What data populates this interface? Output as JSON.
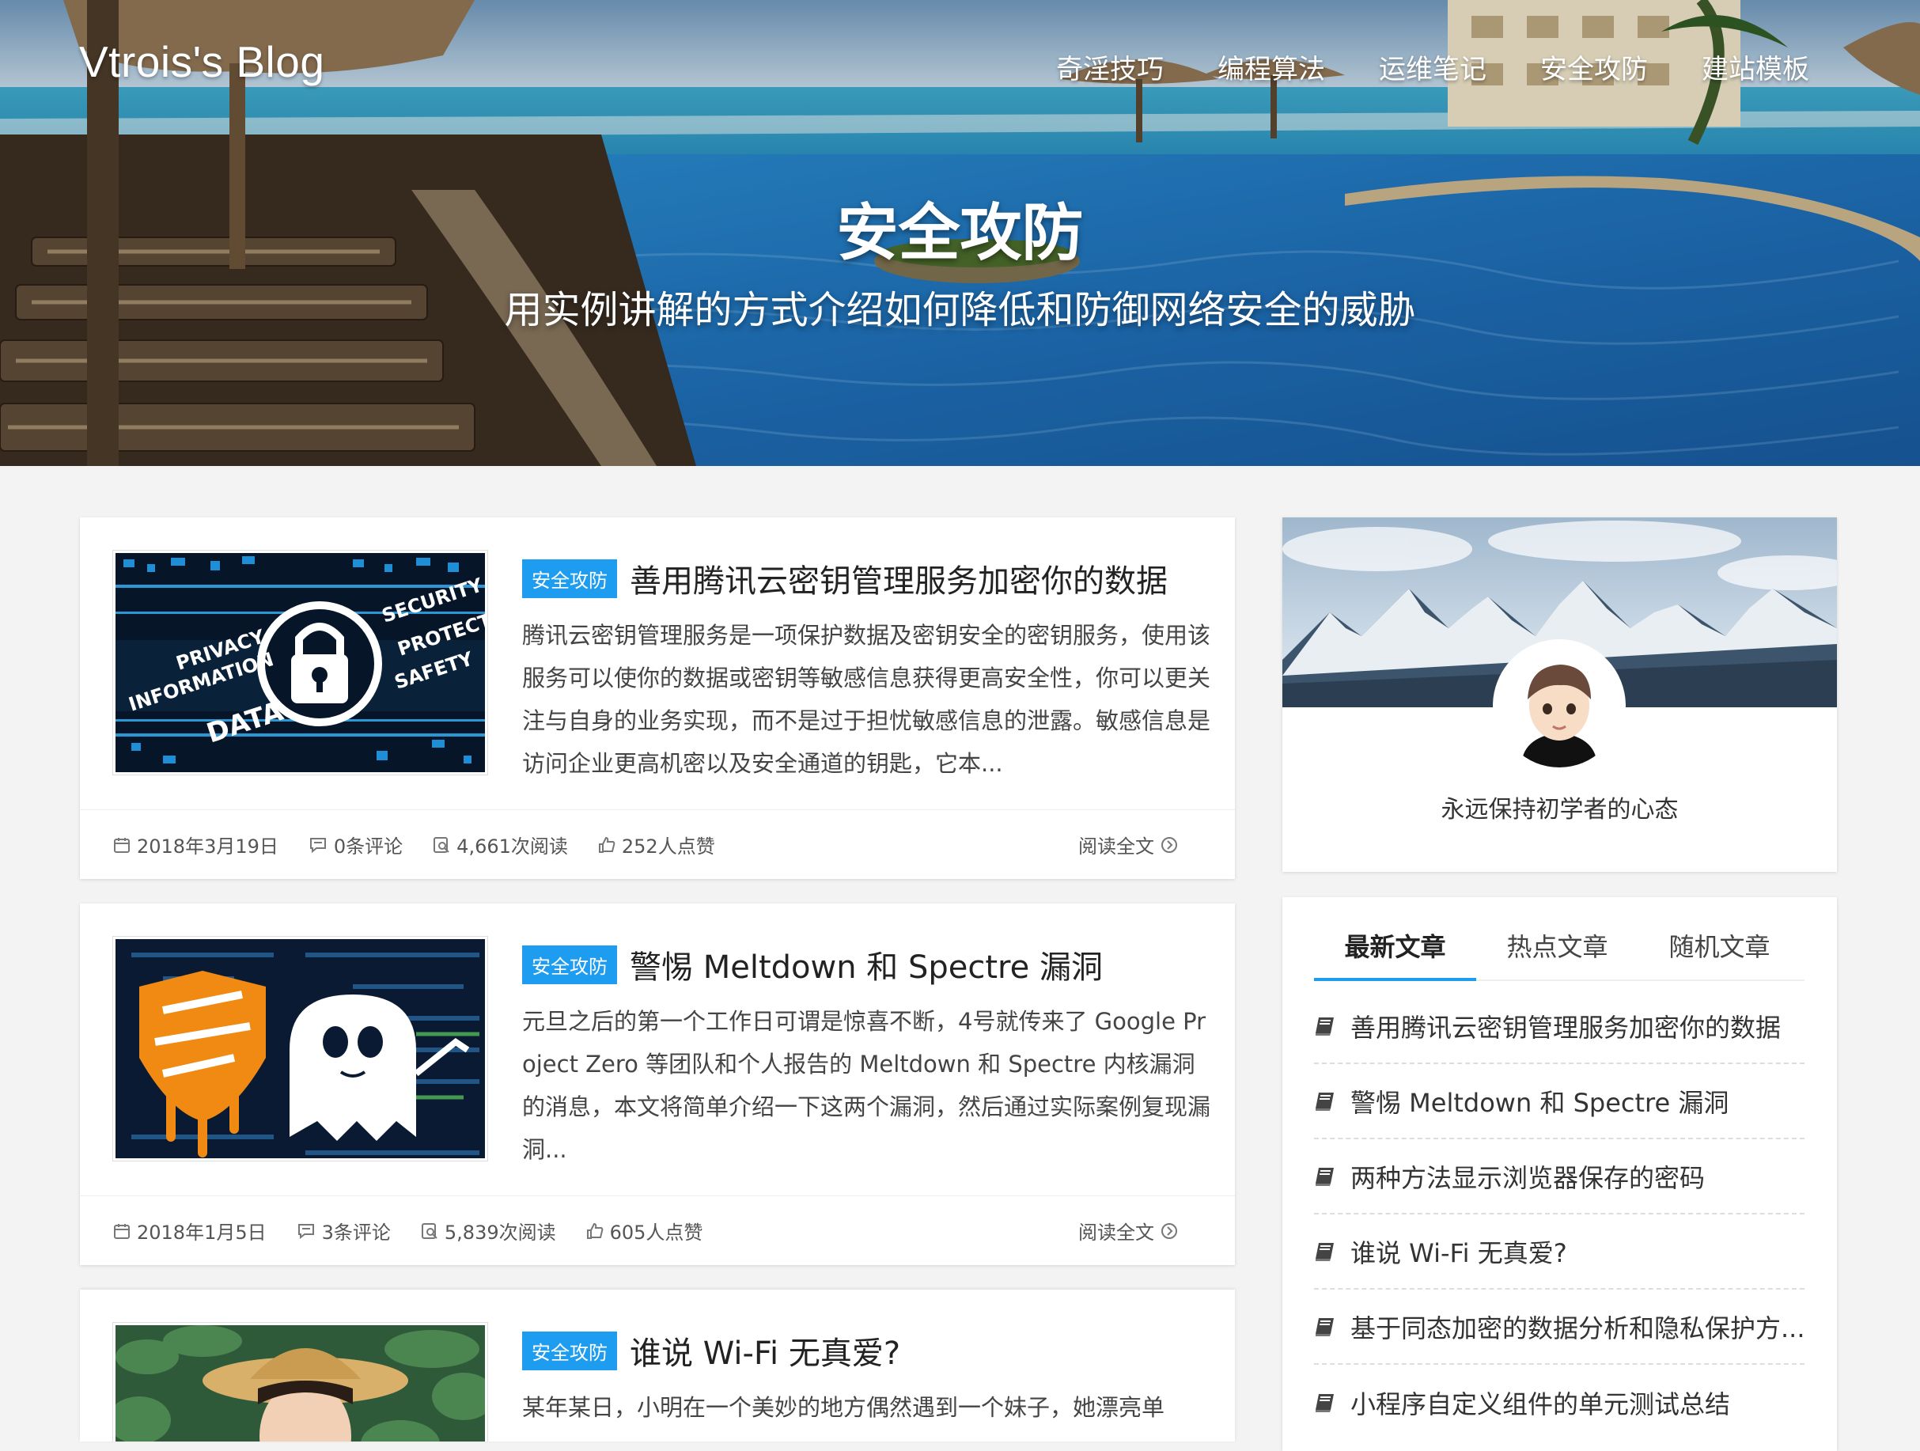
{
  "site": {
    "brand": "Vtrois's Blog"
  },
  "nav": [
    {
      "label": "奇淫技巧"
    },
    {
      "label": "编程算法"
    },
    {
      "label": "运维笔记"
    },
    {
      "label": "安全攻防"
    },
    {
      "label": "建站模板"
    }
  ],
  "hero": {
    "title": "安全攻防",
    "subtitle": "用实例讲解的方式介绍如何降低和防御网络安全的威胁"
  },
  "articles": [
    {
      "tag": "安全攻防",
      "title": "善用腾讯云密钥管理服务加密你的数据",
      "excerpt": "腾讯云密钥管理服务是一项保护数据及密钥安全的密钥服务，使用该服务可以使你的数据或密钥等敏感信息获得更高安全性，你可以更关注与自身的业务实现，而不是过于担忧敏感信息的泄露。敏感信息是访问企业更高机密以及安全通道的钥匙，它本...",
      "date": "2018年3月19日",
      "comments": "0条评论",
      "views": "4,661次阅读",
      "likes": "252人点赞",
      "readmore": "阅读全文",
      "thumb_text": [
        "PRIVACY",
        "INFORMATION",
        "DATA",
        "SECURITY",
        "PROTECT",
        "SAFETY"
      ]
    },
    {
      "tag": "安全攻防",
      "title": "警惕 Meltdown 和 Spectre 漏洞",
      "excerpt": "元旦之后的第一个工作日可谓是惊喜不断，4号就传来了 Google Project Zero 等团队和个人报告的 Meltdown 和 Spectre 内核漏洞的消息，本文将简单介绍一下这两个漏洞，然后通过实际案例复现漏洞...",
      "date": "2018年1月5日",
      "comments": "3条评论",
      "views": "5,839次阅读",
      "likes": "605人点赞",
      "readmore": "阅读全文"
    },
    {
      "tag": "安全攻防",
      "title": "谁说 Wi-Fi 无真爱?",
      "excerpt": "某年某日，小明在一个美妙的地方偶然遇到一个妹子，她漂亮单"
    }
  ],
  "profile": {
    "motto": "永远保持初学者的心态"
  },
  "sidebar": {
    "tabs": [
      {
        "label": "最新文章"
      },
      {
        "label": "热点文章"
      },
      {
        "label": "随机文章"
      }
    ],
    "posts": [
      {
        "title": "善用腾讯云密钥管理服务加密你的数据"
      },
      {
        "title": "警惕 Meltdown 和 Spectre 漏洞"
      },
      {
        "title": "两种方法显示浏览器保存的密码"
      },
      {
        "title": "谁说 Wi-Fi 无真爱?"
      },
      {
        "title": "基于同态加密的数据分析和隐私保护方..."
      },
      {
        "title": "小程序自定义组件的单元测试总结"
      }
    ]
  },
  "colors": {
    "accent": "#1e9df0",
    "background": "#f3f3f3"
  }
}
